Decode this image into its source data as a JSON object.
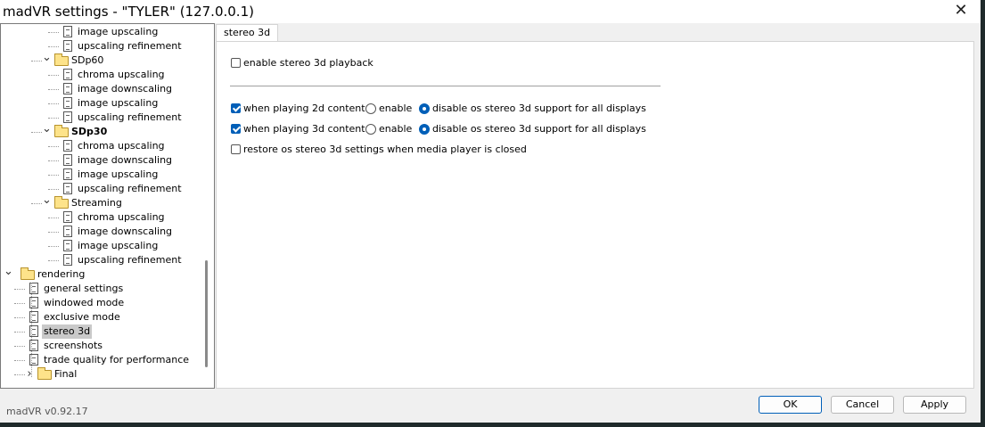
{
  "window": {
    "title": "madVR settings - \"TYLER\" (127.0.0.1)"
  },
  "tree": {
    "items": [
      {
        "label": "image upscaling",
        "level": 3,
        "icon": "page-icon"
      },
      {
        "label": "upscaling refinement",
        "level": 3,
        "icon": "page-icon"
      },
      {
        "label": "SDp60",
        "level": 2,
        "icon": "folder-icon",
        "expander": "expanded"
      },
      {
        "label": "chroma upscaling",
        "level": 3,
        "icon": "page-icon"
      },
      {
        "label": "image downscaling",
        "level": 3,
        "icon": "page-icon"
      },
      {
        "label": "image upscaling",
        "level": 3,
        "icon": "page-icon"
      },
      {
        "label": "upscaling refinement",
        "level": 3,
        "icon": "page-icon"
      },
      {
        "label": "SDp30",
        "level": 2,
        "icon": "folder-icon",
        "expander": "expanded",
        "bold": true
      },
      {
        "label": "chroma upscaling",
        "level": 3,
        "icon": "page-icon"
      },
      {
        "label": "image downscaling",
        "level": 3,
        "icon": "page-icon"
      },
      {
        "label": "image upscaling",
        "level": 3,
        "icon": "page-icon"
      },
      {
        "label": "upscaling refinement",
        "level": 3,
        "icon": "page-icon"
      },
      {
        "label": "Streaming",
        "level": 2,
        "icon": "folder-icon",
        "expander": "expanded"
      },
      {
        "label": "chroma upscaling",
        "level": 3,
        "icon": "page-icon"
      },
      {
        "label": "image downscaling",
        "level": 3,
        "icon": "page-icon"
      },
      {
        "label": "image upscaling",
        "level": 3,
        "icon": "page-icon"
      },
      {
        "label": "upscaling refinement",
        "level": 3,
        "icon": "page-icon"
      },
      {
        "label": "rendering",
        "level": 0,
        "icon": "folder-icon",
        "expander": "expanded"
      },
      {
        "label": "general settings",
        "level": 1,
        "icon": "page-icon"
      },
      {
        "label": "windowed mode",
        "level": 1,
        "icon": "page-icon"
      },
      {
        "label": "exclusive mode",
        "level": 1,
        "icon": "page-icon"
      },
      {
        "label": "stereo 3d",
        "level": 1,
        "icon": "page-icon",
        "selected": true
      },
      {
        "label": "screenshots",
        "level": 1,
        "icon": "page-icon"
      },
      {
        "label": "trade quality for performance",
        "level": 1,
        "icon": "page-icon"
      },
      {
        "label": "Final",
        "level": 1,
        "icon": "folder-icon",
        "expander": "collapsed"
      }
    ]
  },
  "panel": {
    "tab_label": "stereo 3d",
    "enable_playback": {
      "label": "enable stereo 3d playback",
      "checked": false
    },
    "content_2d": {
      "label": "when playing 2d content:",
      "checked": true,
      "enable_label": "enable",
      "disable_label": "disable os stereo 3d support for all displays",
      "selected": "disable"
    },
    "content_3d": {
      "label": "when playing 3d content:",
      "checked": true,
      "enable_label": "enable",
      "disable_label": "disable os stereo 3d support for all displays",
      "selected": "disable"
    },
    "restore": {
      "label": "restore os stereo 3d settings when media player is closed",
      "checked": false
    }
  },
  "footer": {
    "version": "madVR v0.92.17",
    "ok_label": "OK",
    "cancel_label": "Cancel",
    "apply_label": "Apply"
  },
  "colors": {
    "accent": "#005fb8",
    "selection": "#c9c9c9"
  }
}
